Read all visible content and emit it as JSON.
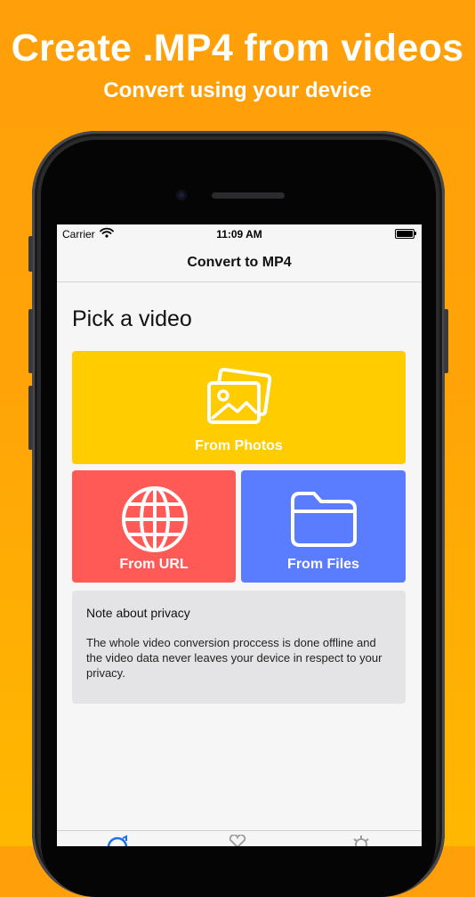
{
  "promo": {
    "headline": "Create .MP4 from videos",
    "subheadline": "Convert using your device"
  },
  "status_bar": {
    "carrier": "Carrier",
    "time": "11:09 AM"
  },
  "navbar": {
    "title": "Convert to MP4"
  },
  "main": {
    "heading": "Pick a video",
    "sources": [
      {
        "label": "From Photos",
        "icon": "photos-icon",
        "color": "#ffcc00"
      },
      {
        "label": "From URL",
        "icon": "globe-icon",
        "color": "#ff5a55"
      },
      {
        "label": "From Files",
        "icon": "folder-icon",
        "color": "#5a7cff"
      }
    ],
    "privacy": {
      "title": "Note about privacy",
      "body": "The whole video conversion proccess is done offline and the video data never leaves your device in respect to your privacy."
    }
  },
  "tab_bar": {
    "icons": [
      "convert-tab-icon",
      "favorites-tab-icon",
      "settings-tab-icon"
    ],
    "active_color": "#1e6ff0"
  }
}
